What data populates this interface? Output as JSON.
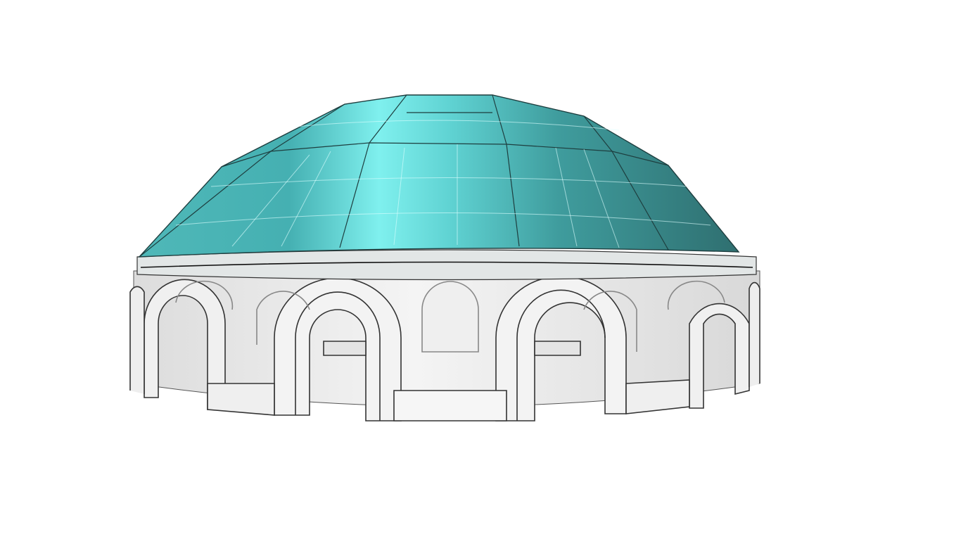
{
  "scene": {
    "subject": "dome-pavilion-model",
    "colors": {
      "background": "#ffffff",
      "dome_light": "#7ff0ee",
      "dome_mid": "#45b5b5",
      "dome_dark": "#2f6f70",
      "wall": "#eeeeee",
      "wall_shade": "#d6d6d6",
      "edge": "#222222"
    }
  }
}
